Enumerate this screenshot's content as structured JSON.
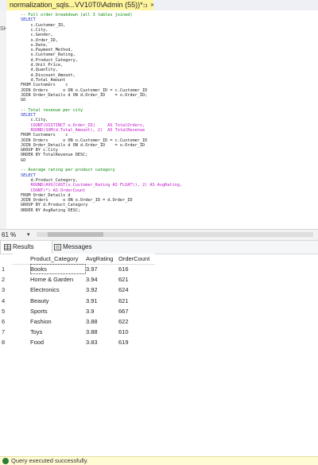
{
  "tab": {
    "title": "normalization_sqls...VV10T0\\Admin (55))*",
    "pin": "⊐",
    "close": "×"
  },
  "left_edge": {
    "label": "SH"
  },
  "editor": {
    "lines": [
      {
        "t": "-- Full order breakdown (all 3 tables joined)",
        "c": "c-comment"
      },
      {
        "t": "SELECT",
        "c": "c-kw"
      },
      {
        "t": "    c.Customer_ID,",
        "c": "c-text"
      },
      {
        "t": "    c.City,",
        "c": "c-text"
      },
      {
        "t": "    c.Gender,",
        "c": "c-text"
      },
      {
        "t": "    o.Order_ID,",
        "c": "c-text"
      },
      {
        "t": "    o.Date,",
        "c": "c-text"
      },
      {
        "t": "    o.Payment_Method,",
        "c": "c-text"
      },
      {
        "t": "    o.Customer_Rating,",
        "c": "c-text"
      },
      {
        "t": "    d.Product_Category,",
        "c": "c-text"
      },
      {
        "t": "    d.Unit_Price,",
        "c": "c-text"
      },
      {
        "t": "    d.Quantity,",
        "c": "c-text"
      },
      {
        "t": "    d.Discount_Amount,",
        "c": "c-text"
      },
      {
        "t": "    d.Total_Amount",
        "c": "c-text"
      },
      {
        "t": "FROM Customers    c",
        "c": "c-text"
      },
      {
        "t": "JOIN Orders      o ON o.Customer_ID = c.Customer_ID",
        "c": "c-text"
      },
      {
        "t": "JOIN Order_Details d ON d.Order_ID    = o.Order_ID;",
        "c": "c-text"
      },
      {
        "t": "GO",
        "c": "c-text"
      },
      {
        "t": "",
        "c": "c-text"
      },
      {
        "t": "-- Total revenue per city",
        "c": "c-comment"
      },
      {
        "t": "SELECT",
        "c": "c-kw"
      },
      {
        "t": "    c.City,",
        "c": "c-text"
      },
      {
        "t": "    COUNT(DISTINCT o.Order_ID)     AS TotalOrders,",
        "c": "c-fn"
      },
      {
        "t": "    ROUND(SUM(d.Total_Amount), 2)  AS TotalRevenue",
        "c": "c-fn"
      },
      {
        "t": "FROM Customers    c",
        "c": "c-text"
      },
      {
        "t": "JOIN Orders      o ON o.Customer_ID = c.Customer_ID",
        "c": "c-text"
      },
      {
        "t": "JOIN Order_Details d ON d.Order_ID    = o.Order_ID",
        "c": "c-text"
      },
      {
        "t": "GROUP BY c.City",
        "c": "c-text"
      },
      {
        "t": "ORDER BY TotalRevenue DESC;",
        "c": "c-text"
      },
      {
        "t": "GO",
        "c": "c-text"
      },
      {
        "t": "",
        "c": "c-text"
      },
      {
        "t": "-- Average rating per product category",
        "c": "c-comment"
      },
      {
        "t": "SELECT",
        "c": "c-kw"
      },
      {
        "t": "    d.Product_Category,",
        "c": "c-text"
      },
      {
        "t": "    ROUND(AVG(CAST(o.Customer_Rating AS FLOAT)), 2) AS AvgRating,",
        "c": "c-fn"
      },
      {
        "t": "    COUNT(*) AS OrderCount",
        "c": "c-fn"
      },
      {
        "t": "FROM Order_Details d",
        "c": "c-text"
      },
      {
        "t": "JOIN Orders      o ON o.Order_ID = d.Order_ID",
        "c": "c-text"
      },
      {
        "t": "GROUP BY d.Product_Category",
        "c": "c-text"
      },
      {
        "t": "ORDER BY AvgRating DESC;",
        "c": "c-text"
      }
    ]
  },
  "zoom": {
    "value": "61 %",
    "chevron": "▾"
  },
  "results": {
    "tabs": [
      {
        "label": "Results"
      },
      {
        "label": "Messages"
      }
    ],
    "columns": [
      "Product_Category",
      "AvgRating",
      "OrderCount"
    ],
    "rows": [
      {
        "n": "1",
        "cat": "Books",
        "avg": "3.97",
        "cnt": "616"
      },
      {
        "n": "2",
        "cat": "Home & Garden",
        "avg": "3.94",
        "cnt": "621"
      },
      {
        "n": "3",
        "cat": "Electronics",
        "avg": "3.92",
        "cnt": "624"
      },
      {
        "n": "4",
        "cat": "Beauty",
        "avg": "3.91",
        "cnt": "621"
      },
      {
        "n": "5",
        "cat": "Sports",
        "avg": "3.9",
        "cnt": "667"
      },
      {
        "n": "6",
        "cat": "Fashion",
        "avg": "3.88",
        "cnt": "622"
      },
      {
        "n": "7",
        "cat": "Toys",
        "avg": "3.88",
        "cnt": "610"
      },
      {
        "n": "8",
        "cat": "Food",
        "avg": "3.83",
        "cnt": "619"
      }
    ]
  },
  "status": {
    "text": "Query executed successfully."
  }
}
